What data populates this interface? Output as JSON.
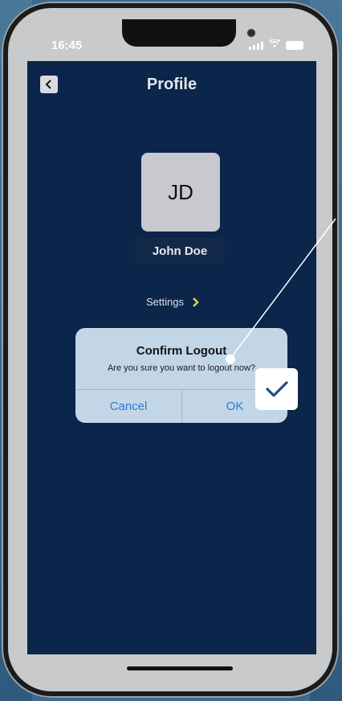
{
  "status_bar": {
    "time": "16:45",
    "icons": [
      "signal-icon",
      "wifi-icon",
      "battery-icon"
    ]
  },
  "header": {
    "title": "Profile",
    "back_icon": "chevron-left-icon"
  },
  "profile": {
    "initials": "JD",
    "name": "John Doe"
  },
  "settings": {
    "label": "Settings",
    "chevron_icon": "chevron-right-icon"
  },
  "dialog": {
    "title": "Confirm Logout",
    "message": "Are you sure you want to logout now?",
    "cancel_label": "Cancel",
    "ok_label": "OK"
  },
  "annotation": {
    "icon": "checkmark-icon"
  },
  "colors": {
    "app_background": "#0b254b",
    "dialog_background": "#c3d6e6",
    "button_text": "#2d7bd6",
    "chevron_accent": "#cfd14c"
  }
}
